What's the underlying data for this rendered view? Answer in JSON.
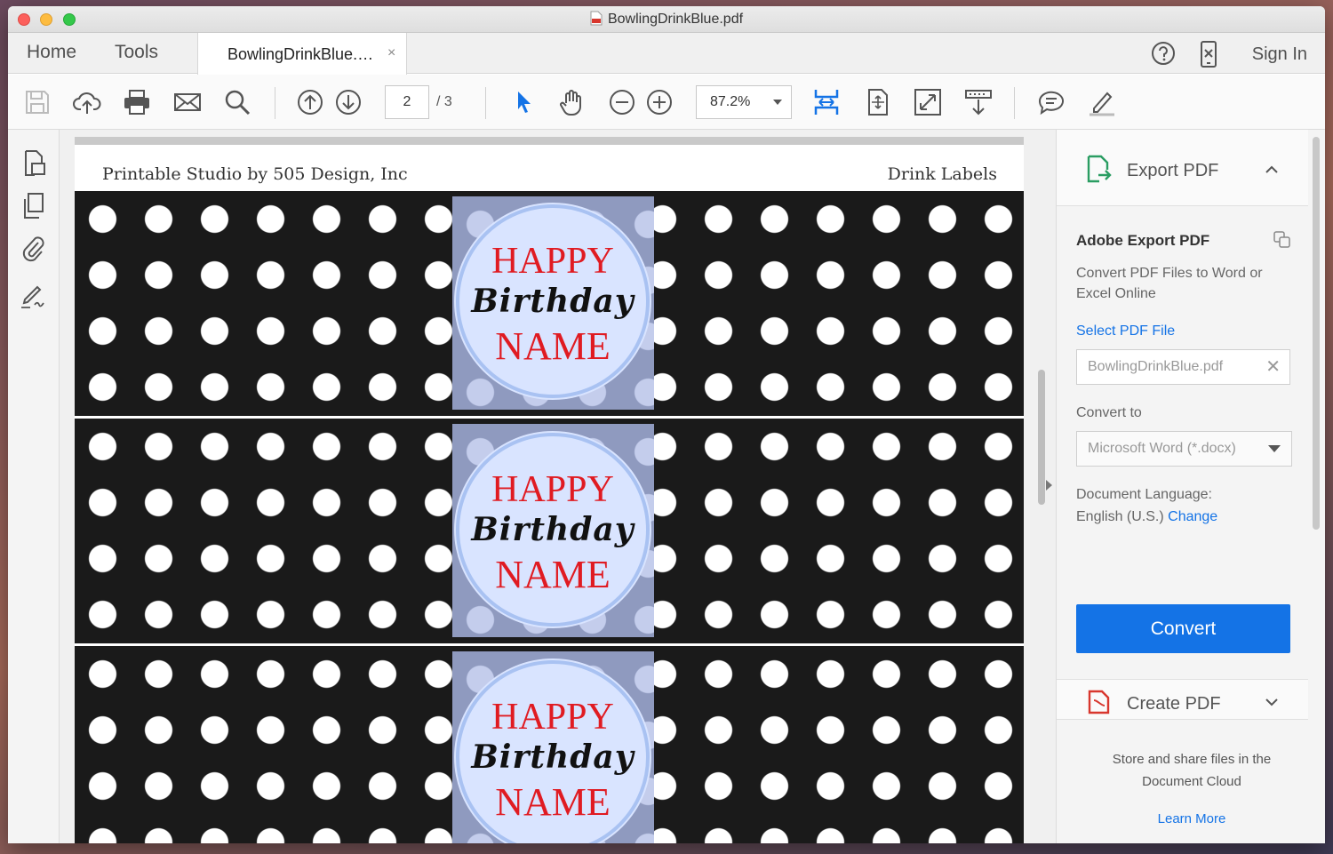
{
  "window": {
    "title": "BowlingDrinkBlue.pdf"
  },
  "tabs": {
    "home": "Home",
    "tools": "Tools",
    "document_tab": "BowlingDrinkBlue.…",
    "close": "×",
    "sign_in": "Sign In"
  },
  "toolbar": {
    "current_page": "2",
    "page_total": "/ 3",
    "zoom": "87.2%"
  },
  "document": {
    "header_left": "Printable Studio by 505 Design, Inc",
    "header_right": "Drink Labels",
    "labels": [
      {
        "line1": "HAPPY",
        "line2": "Birthday",
        "line3": "NAME"
      },
      {
        "line1": "HAPPY",
        "line2": "Birthday",
        "line3": "NAME"
      },
      {
        "line1": "HAPPY",
        "line2": "Birthday",
        "line3": "NAME"
      }
    ]
  },
  "right_panel": {
    "export_title": "Export PDF",
    "adobe_export_title": "Adobe Export PDF",
    "description": "Convert PDF Files to Word or Excel Online",
    "select_link": "Select PDF File",
    "file_value": "BowlingDrinkBlue.pdf",
    "convert_to_label": "Convert to",
    "format_value": "Microsoft Word (*.docx)",
    "doc_language_label": "Document Language:",
    "doc_language_value": "English (U.S.)",
    "change_link": "Change",
    "convert_button": "Convert",
    "create_title": "Create PDF",
    "cloud_text": "Store and share files in the Document Cloud",
    "learn_more": "Learn More"
  },
  "colors": {
    "accent_blue": "#1473e6",
    "label_red": "#e01b22",
    "medallion_fill": "#d9e4ff"
  }
}
